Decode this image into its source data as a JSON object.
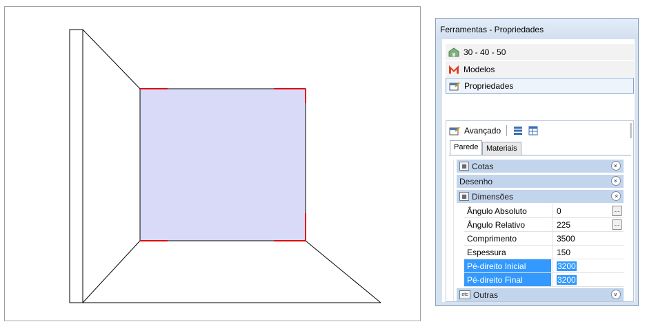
{
  "panel": {
    "title": "Ferramentas - Propriedades",
    "nav": [
      {
        "label": "30 - 40 - 50",
        "icon": "building-icon"
      },
      {
        "label": "Modelos",
        "icon": "models-m-icon"
      },
      {
        "label": "Propriedades",
        "icon": "properties-icon",
        "selected": true
      }
    ],
    "advanced_label": "Avançado",
    "tabs": [
      "Parede",
      "Materiais"
    ],
    "categories": {
      "cotas": "Cotas",
      "desenho": "Desenho",
      "dimensoes": "Dimensões",
      "outras": "Outras",
      "outras_icon_text": "etc"
    },
    "properties": [
      {
        "name": "Ângulo Absoluto",
        "value": "0"
      },
      {
        "name": "Ângulo Relativo",
        "value": "225"
      },
      {
        "name": "Comprimento",
        "value": "3500"
      },
      {
        "name": "Espessura",
        "value": "150"
      },
      {
        "name": "Pé-direito Inicial",
        "value": "3200"
      },
      {
        "name": "Pé-direito Final",
        "value": "3200"
      }
    ],
    "ellipsis": "...",
    "chevron_down": "»",
    "chevron_up": "«"
  },
  "colors": {
    "wall_face": "#d8daf8",
    "wall_edge_red": "#e00000",
    "selection": "#3399ff"
  }
}
